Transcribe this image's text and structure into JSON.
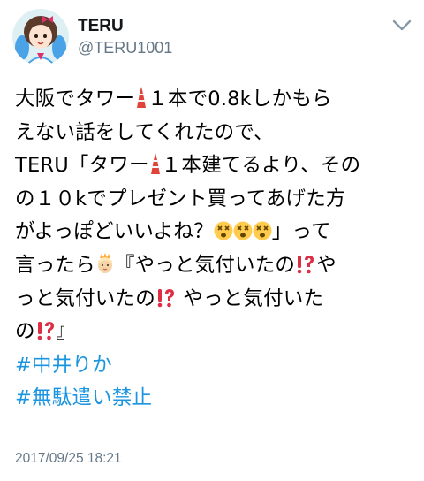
{
  "user": {
    "name": "TERU",
    "handle": "@TERU1001"
  },
  "tweet": {
    "line1a": "大阪でタワー",
    "line1b": "１本で0.8kしかもら",
    "line2": "えない話をしてくれたので、",
    "line3a": "TERU「タワー",
    "line3b": "１本建てるより、その",
    "line4": "の１０kでプレゼント買ってあげた方",
    "line5a": "がよっぽどいいよね？",
    "line5b": "」って",
    "line6a": "言ったら",
    "line6b": "『やっと気付いたの",
    "line6c": "や",
    "line7a": "っと気付いたの",
    "line7b": "やっと気付いた",
    "line8a": "の",
    "line8b": "』",
    "hashtag1": "#中井りか",
    "hashtag2": "#無駄遣い禁止"
  },
  "icons": [
    "tokyo-tower-emoji",
    "dizzy-face-emoji",
    "princess-emoji",
    "exclamation-question-emoji",
    "chevron-down-icon"
  ],
  "timestamp": "2017/09/25 18:21",
  "colors": {
    "link": "#1b95e0",
    "secondary": "#657786",
    "text": "#000000"
  }
}
